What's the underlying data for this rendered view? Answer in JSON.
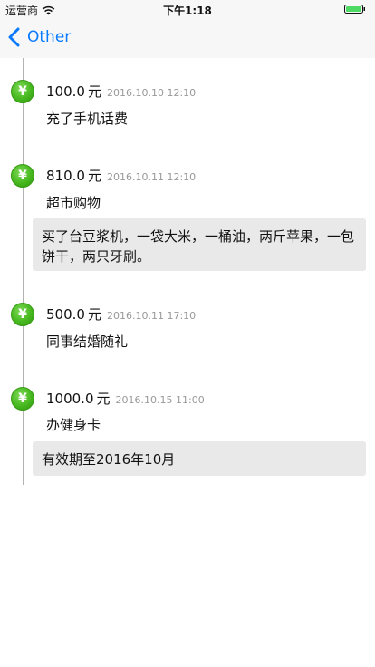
{
  "status_bar": {
    "carrier": "运营商",
    "time": "下午1:18"
  },
  "nav": {
    "back_label": "Other"
  },
  "entries": [
    {
      "amount": "100.0",
      "unit": "元",
      "time": "2016.10.10 12:10",
      "title": "充了手机话费",
      "note": ""
    },
    {
      "amount": "810.0",
      "unit": "元",
      "time": "2016.10.11 12:10",
      "title": "超市购物",
      "note": "买了台豆浆机，一袋大米，一桶油，两斤苹果，一包饼干，两只牙刷。"
    },
    {
      "amount": "500.0",
      "unit": "元",
      "time": "2016.10.11 17:10",
      "title": "同事结婚随礼",
      "note": ""
    },
    {
      "amount": "1000.0",
      "unit": "元",
      "time": "2016.10.15 11:00",
      "title": "办健身卡",
      "note": "有效期至2016年10月"
    }
  ],
  "icons": {
    "entry_badge": "yen-icon",
    "badge_glyph": "¥",
    "badge_color": "#46b81e",
    "accent": "#0a7aff"
  }
}
